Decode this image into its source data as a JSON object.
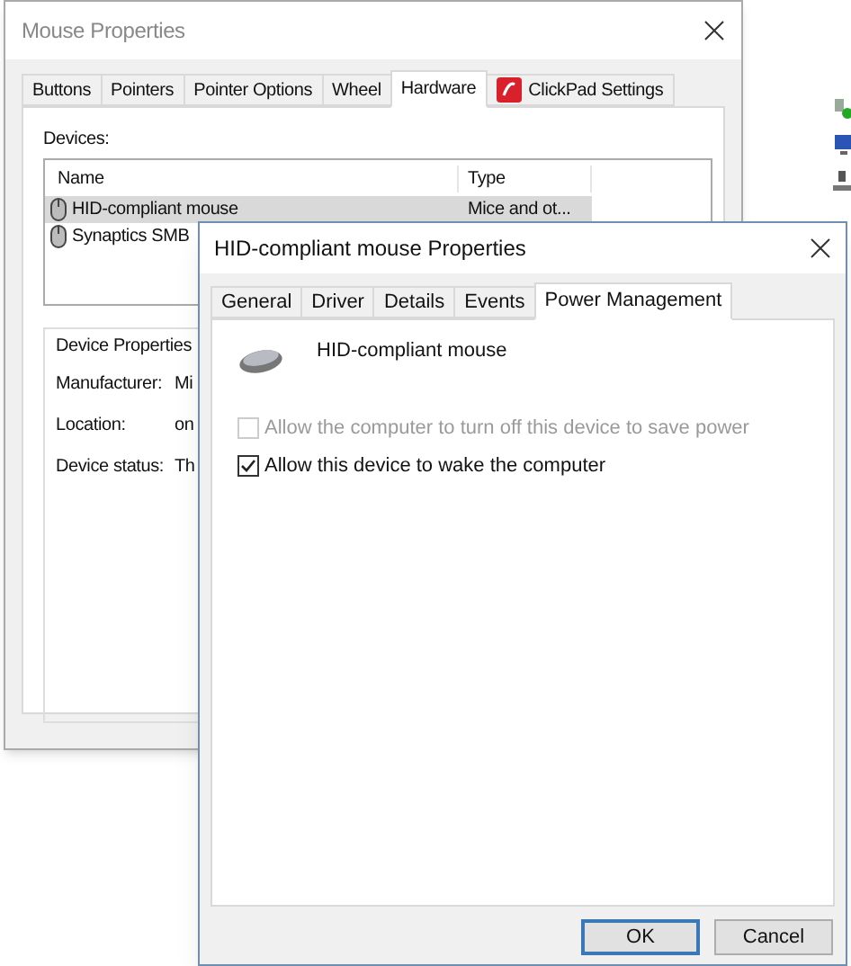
{
  "back_window": {
    "title": "Mouse Properties",
    "tabs": [
      {
        "label": "Buttons",
        "selected": false
      },
      {
        "label": "Pointers",
        "selected": false
      },
      {
        "label": "Pointer Options",
        "selected": false
      },
      {
        "label": "Wheel",
        "selected": false
      },
      {
        "label": "Hardware",
        "selected": true
      },
      {
        "label": "ClickPad Settings",
        "selected": false,
        "kind": "logo"
      }
    ],
    "devices_label": "Devices:",
    "columns": [
      "Name",
      "Type"
    ],
    "rows": [
      {
        "name": "HID-compliant mouse",
        "type": "Mice and ot...",
        "selected": true
      },
      {
        "name": "Synaptics SMB",
        "type": "",
        "selected": false
      }
    ],
    "group_title": "Device Properties",
    "properties": [
      {
        "label": "Manufacturer:",
        "value": "Mi"
      },
      {
        "label": "Location:",
        "value": "on"
      },
      {
        "label": "Device status:",
        "value": "Th"
      }
    ]
  },
  "front_window": {
    "title": "HID-compliant mouse Properties",
    "tabs": [
      {
        "label": "General",
        "selected": false
      },
      {
        "label": "Driver",
        "selected": false
      },
      {
        "label": "Details",
        "selected": false
      },
      {
        "label": "Events",
        "selected": false
      },
      {
        "label": "Power Management",
        "selected": true
      }
    ],
    "device_name": "HID-compliant mouse",
    "options": [
      {
        "label": "Allow the computer to turn off this device to save power",
        "checked": false,
        "disabled": true
      },
      {
        "label": "Allow this device to wake the computer",
        "checked": true,
        "disabled": false
      }
    ],
    "buttons": [
      {
        "label": "OK",
        "default": true
      },
      {
        "label": "Cancel",
        "default": false
      }
    ]
  }
}
